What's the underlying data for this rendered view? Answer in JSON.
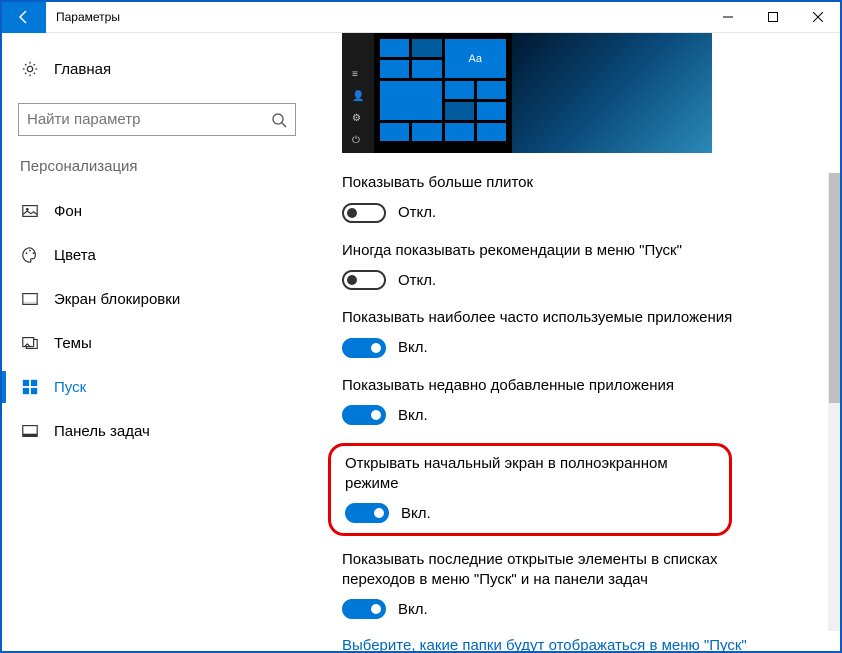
{
  "window": {
    "title": "Параметры"
  },
  "sidebar": {
    "home": "Главная",
    "searchPlaceholder": "Найти параметр",
    "section": "Персонализация",
    "items": [
      {
        "label": "Фон"
      },
      {
        "label": "Цвета"
      },
      {
        "label": "Экран блокировки"
      },
      {
        "label": "Темы"
      },
      {
        "label": "Пуск"
      },
      {
        "label": "Панель задач"
      }
    ]
  },
  "content": {
    "previewAa": "Aa",
    "settings": [
      {
        "label": "Показывать больше плиток",
        "state": "off",
        "stateText": "Откл."
      },
      {
        "label": "Иногда показывать рекомендации в меню \"Пуск\"",
        "state": "off",
        "stateText": "Откл."
      },
      {
        "label": "Показывать наиболее часто используемые приложения",
        "state": "on",
        "stateText": "Вкл."
      },
      {
        "label": "Показывать недавно добавленные приложения",
        "state": "on",
        "stateText": "Вкл."
      },
      {
        "label": "Открывать начальный экран в полноэкранном режиме",
        "state": "on",
        "stateText": "Вкл."
      },
      {
        "label": "Показывать последние открытые элементы в списках переходов в меню \"Пуск\" и на панели задач",
        "state": "on",
        "stateText": "Вкл."
      }
    ],
    "link": "Выберите, какие папки будут отображаться в меню \"Пуск\""
  }
}
